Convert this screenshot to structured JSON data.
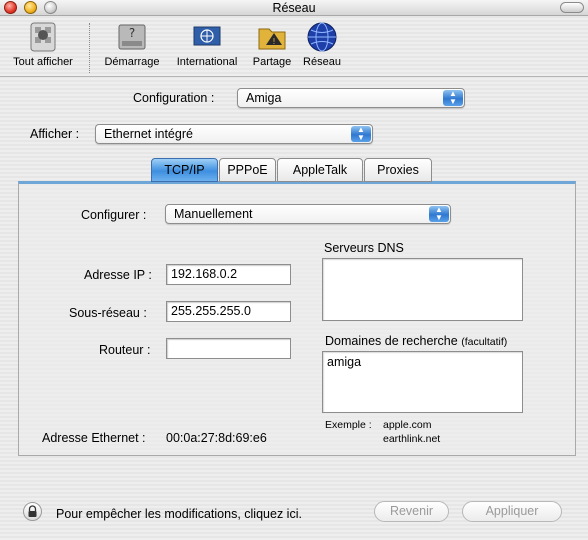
{
  "window": {
    "title": "Réseau"
  },
  "toolbar": {
    "items": [
      {
        "label": "Tout afficher",
        "icon": "show-all-icon"
      },
      {
        "label": "Démarrage",
        "icon": "startup-disk-icon"
      },
      {
        "label": "International",
        "icon": "international-flag-icon"
      },
      {
        "label": "Partage",
        "icon": "sharing-icon"
      },
      {
        "label": "Réseau",
        "icon": "network-globe-icon"
      }
    ]
  },
  "configuration": {
    "label": "Configuration :",
    "value": "Amiga"
  },
  "afficher": {
    "label": "Afficher :",
    "value": "Ethernet intégré"
  },
  "tabs": [
    {
      "label": "TCP/IP",
      "active": true
    },
    {
      "label": "PPPoE",
      "active": false
    },
    {
      "label": "AppleTalk",
      "active": false
    },
    {
      "label": "Proxies",
      "active": false
    }
  ],
  "tcpip": {
    "configurer": {
      "label": "Configurer :",
      "value": "Manuellement"
    },
    "ip": {
      "label": "Adresse IP :",
      "value": "192.168.0.2"
    },
    "subnet": {
      "label": "Sous-réseau :",
      "value": "255.255.255.0"
    },
    "router": {
      "label": "Routeur :",
      "value": ""
    },
    "dns": {
      "label": "Serveurs DNS",
      "value": ""
    },
    "search_domains": {
      "label": "Domaines de recherche",
      "optional": "(facultatif)",
      "value": "amiga"
    },
    "example": {
      "label": "Exemple :",
      "line1": "apple.com",
      "line2": "earthlink.net"
    },
    "ethernet": {
      "label": "Adresse Ethernet :",
      "value": "00:0a:27:8d:69:e6"
    }
  },
  "footer": {
    "lock_text": "Pour empêcher les modifications, cliquez ici.",
    "revert_label": "Revenir",
    "apply_label": "Appliquer"
  },
  "colors": {
    "accent": "#3d8fe0",
    "panel_top": "#6ea6d8"
  }
}
